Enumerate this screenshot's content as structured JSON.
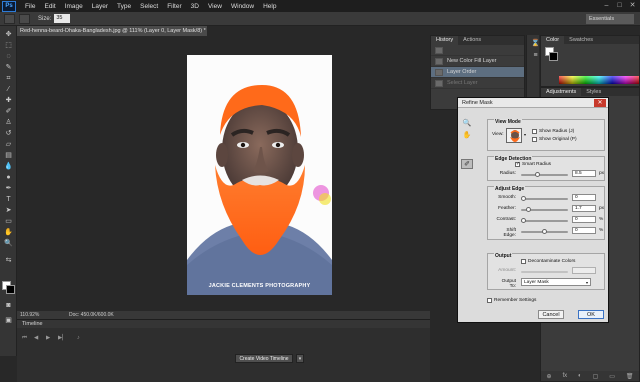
{
  "app": {
    "logo": "Ps"
  },
  "menu": [
    "File",
    "Edit",
    "Image",
    "Layer",
    "Type",
    "Select",
    "Filter",
    "3D",
    "View",
    "Window",
    "Help"
  ],
  "window_controls": [
    "–",
    "□",
    "✕"
  ],
  "options_bar": {
    "size_label": "Size:",
    "size_value": "35",
    "workspace": "Essentials"
  },
  "document": {
    "tab_title": "Red-henna-beard-Dhaka-Bangladesh.jpg @ 111% (Layer 0, Layer Mask/8) *",
    "zoom": "110.92%",
    "doc_size": "Doc: 450.0K/600.0K",
    "watermark": "JACKIE CLEMENTS PHOTOGRAPHY"
  },
  "timeline": {
    "title": "Timeline",
    "create_button": "Create Video Timeline",
    "dropdown_arrow": "▾"
  },
  "history": {
    "tabs": [
      "History",
      "Actions"
    ],
    "items": [
      {
        "label": "",
        "state": "normal"
      },
      {
        "label": "New Color Fill Layer",
        "state": "normal"
      },
      {
        "label": "Layer Order",
        "state": "selected"
      },
      {
        "label": "Select Layer",
        "state": "dim"
      }
    ]
  },
  "color_panel": {
    "tabs": [
      "Color",
      "Swatches"
    ]
  },
  "adjustments_panel": {
    "tabs": [
      "Adjustments",
      "Styles"
    ],
    "footer_icons": [
      "⊕",
      "fx",
      "◐",
      "▢",
      "▭",
      "🗑"
    ]
  },
  "refine_mask": {
    "title": "Refine Mask",
    "close_glyph": "✕",
    "view_mode": {
      "title": "View Mode",
      "view_label": "View:",
      "show_radius": "Show Radius (J)",
      "show_original": "Show Original (P)"
    },
    "edge_detection": {
      "title": "Edge Detection",
      "smart_radius": "Smart Radius",
      "smart_radius_checked": true,
      "radius_label": "Radius:",
      "radius_value": "8.5",
      "radius_unit": "px",
      "radius_slider": 0.34
    },
    "adjust_edge": {
      "title": "Adjust Edge",
      "rows": [
        {
          "label": "Smooth:",
          "value": "0",
          "unit": "",
          "slider": 0.0
        },
        {
          "label": "Feather:",
          "value": "1.7",
          "unit": "px",
          "slider": 0.12
        },
        {
          "label": "Contrast:",
          "value": "0",
          "unit": "%",
          "slider": 0.0
        },
        {
          "label": "Shift Edge:",
          "value": "0",
          "unit": "%",
          "slider": 0.5
        }
      ]
    },
    "output": {
      "title": "Output",
      "decontaminate": "Decontaminate Colors",
      "amount_label": "Amount:",
      "output_to_label": "Output To:",
      "output_to_value": "Layer Mask"
    },
    "remember": "Remember Settings",
    "cancel": "Cancel",
    "ok": "OK"
  },
  "colors": {
    "accent_blue": "#3b73c4",
    "henna": "#ff6a1a",
    "selected_row": "#5d6e80"
  }
}
